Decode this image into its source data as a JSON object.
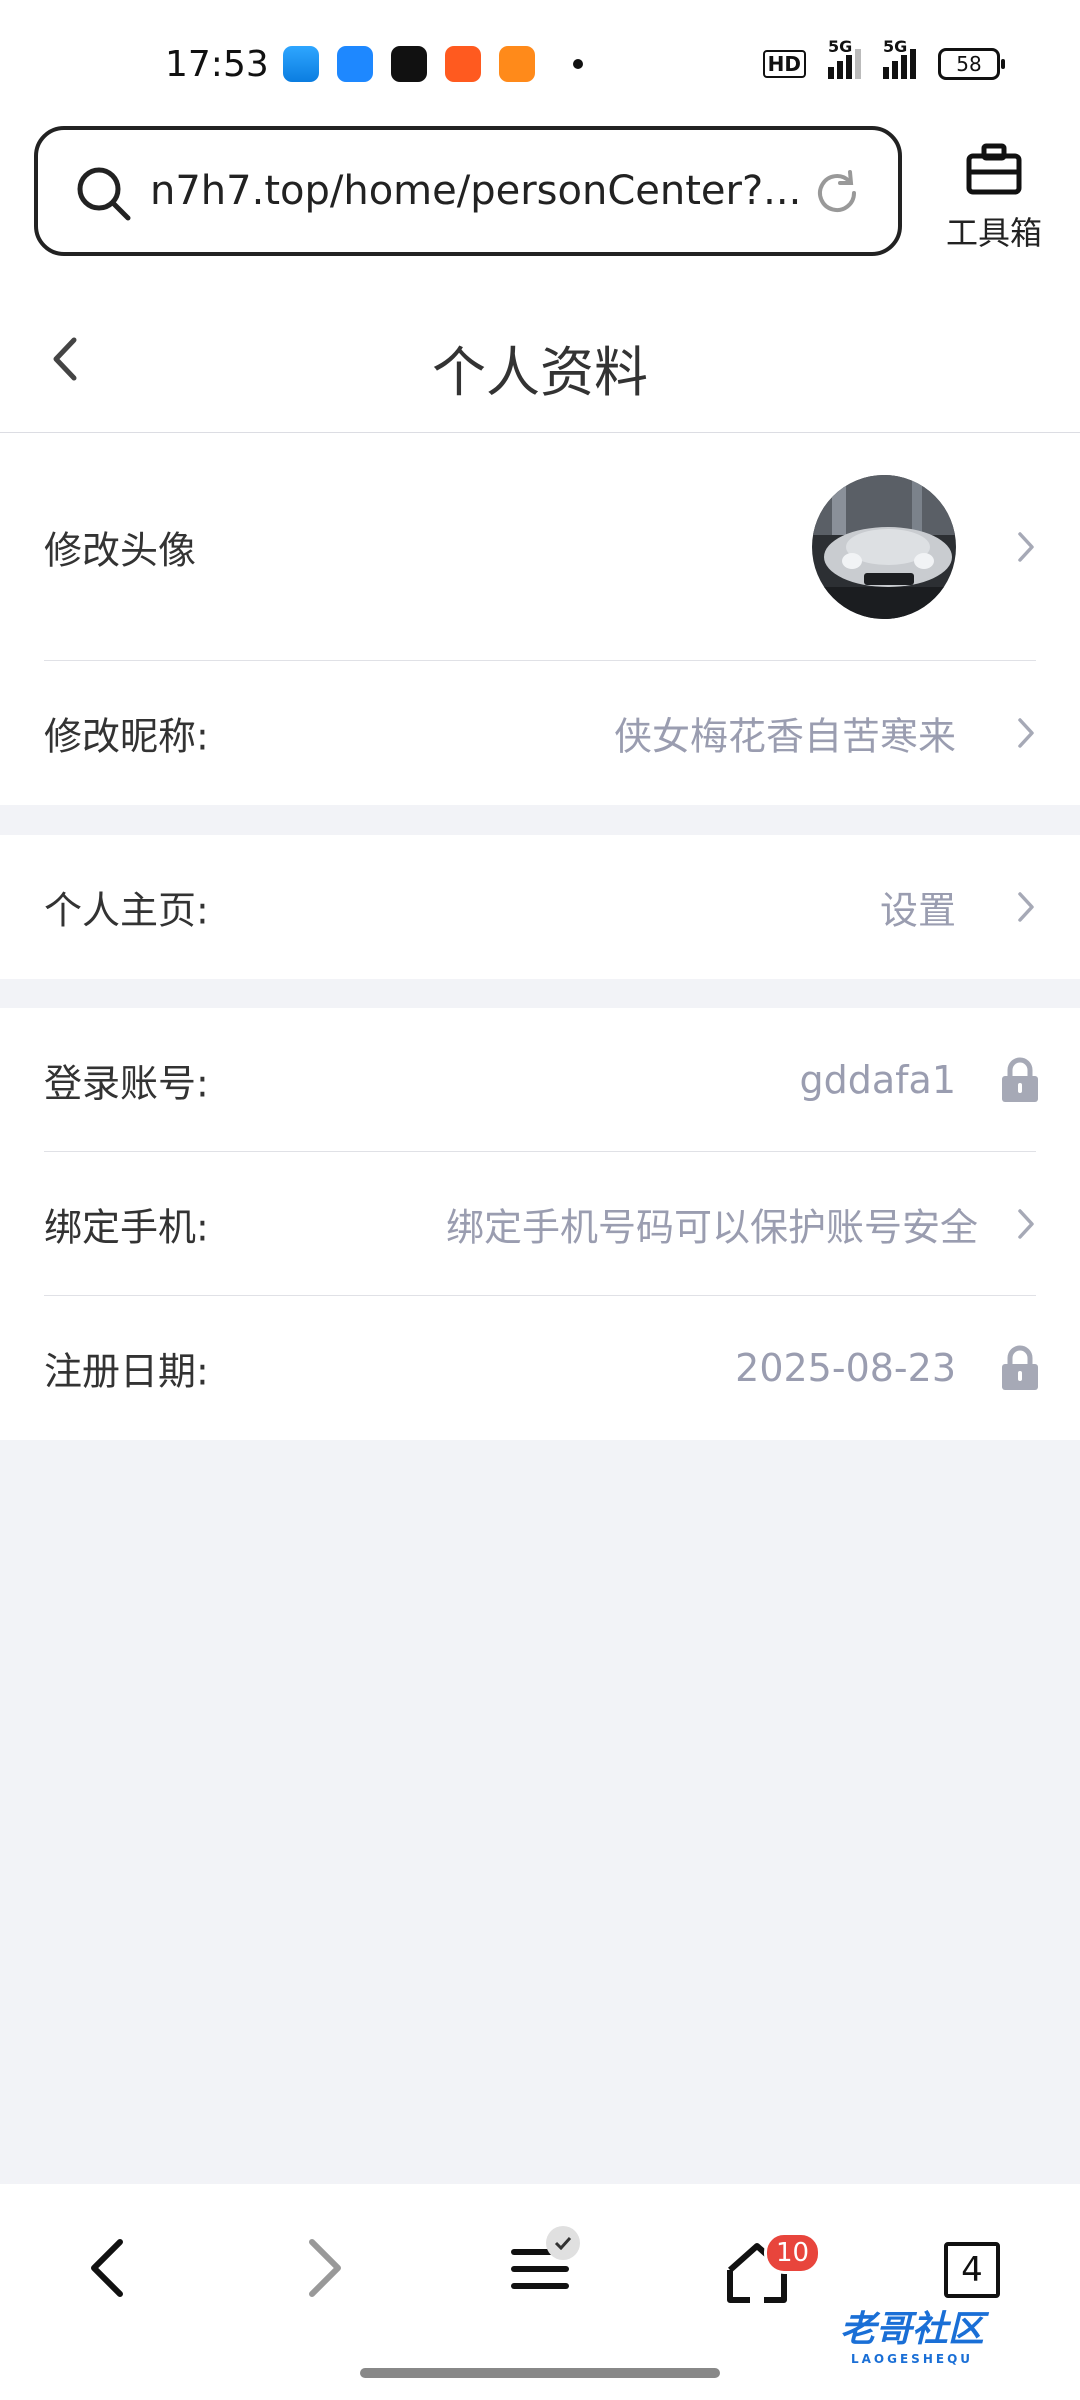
{
  "status_bar": {
    "time": "17:53",
    "hd_label": "HD",
    "sim1_label": "5G",
    "sim2_label": "5G",
    "battery": "58"
  },
  "browser": {
    "url": "n7h7.top/home/personCenter?...",
    "toolbox_label": "工具箱"
  },
  "page": {
    "title": "个人资料"
  },
  "rows": {
    "avatar": {
      "label": "修改头像"
    },
    "nickname": {
      "label": "修改昵称:",
      "value": "侠女梅花香自苦寒来"
    },
    "homepage": {
      "label": "个人主页:",
      "value": "设置"
    },
    "account": {
      "label": "登录账号:",
      "value": "gddafa1"
    },
    "phone": {
      "label": "绑定手机:",
      "value": "绑定手机号码可以保护账号安全"
    },
    "register": {
      "label": "注册日期:",
      "value": "2025-08-23"
    }
  },
  "bottom_nav": {
    "menu_badge_icon": "check-icon",
    "home_badge": "10",
    "tab_count": "4"
  },
  "watermark": {
    "text": "老哥社区",
    "sub": "LAOGESHEQU"
  },
  "colors": {
    "accent_badge": "#e8453c",
    "value_gray": "#9a9db0",
    "page_bg": "#f2f3f7"
  }
}
